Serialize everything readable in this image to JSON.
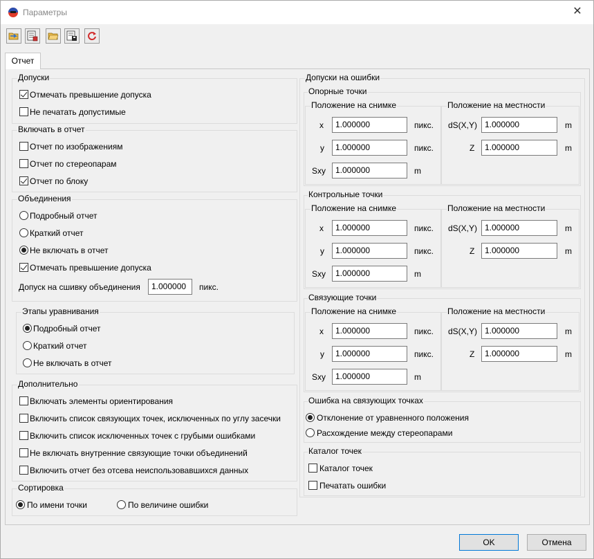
{
  "window": {
    "title": "Параметры"
  },
  "tabs": [
    "Отчет"
  ],
  "left": {
    "tolerances": {
      "title": "Допуски",
      "items": [
        {
          "label": "Отмечать превышение допуска",
          "checked": true
        },
        {
          "label": "Не печатать допустимые",
          "checked": false
        }
      ]
    },
    "include": {
      "title": "Включать в отчет",
      "items": [
        {
          "label": "Отчет по изображениям",
          "checked": false
        },
        {
          "label": "Отчет по стереопарам",
          "checked": false
        },
        {
          "label": "Отчет по блоку",
          "checked": true
        }
      ]
    },
    "merges": {
      "title": "Объединения",
      "radios": [
        {
          "label": "Подробный отчет",
          "checked": false
        },
        {
          "label": "Краткий отчет",
          "checked": false
        },
        {
          "label": "Не включать в отчет",
          "checked": true
        }
      ],
      "check": {
        "label": "Отмечать превышение допуска",
        "checked": true
      },
      "stitch_label": "Допуск на сшивку объединения",
      "stitch_value": "1.000000",
      "stitch_unit": "пикс."
    },
    "stages": {
      "title": "Этапы уравнивания",
      "radios": [
        {
          "label": "Подробный отчет",
          "checked": true
        },
        {
          "label": "Краткий отчет",
          "checked": false
        },
        {
          "label": "Не включать в отчет",
          "checked": false
        }
      ]
    },
    "extra": {
      "title": "Дополнительно",
      "items": [
        {
          "label": "Включать элементы ориентирования",
          "checked": false
        },
        {
          "label": "Включить список связующих точек, исключенных по углу засечки",
          "checked": false
        },
        {
          "label": "Включить список исключенных точек с грубыми ошибками",
          "checked": false
        },
        {
          "label": "Не включать внутренние связующие точки объединений",
          "checked": false
        },
        {
          "label": "Включить отчет без отсева неиспользовавшихся данных",
          "checked": false
        }
      ]
    },
    "sort": {
      "title": "Сортировка",
      "radios": [
        {
          "label": "По имени точки",
          "checked": true
        },
        {
          "label": "По величине ошибки",
          "checked": false
        }
      ]
    }
  },
  "right": {
    "title": "Допуски на ошибки",
    "groups": [
      {
        "title": "Опорные точки",
        "image_title": "Положение на снимке",
        "ground_title": "Положение на местности",
        "image_rows": [
          {
            "label": "x",
            "value": "1.000000",
            "unit": "пикс."
          },
          {
            "label": "y",
            "value": "1.000000",
            "unit": "пикс."
          },
          {
            "label": "Sxy",
            "value": "1.000000",
            "unit": "m"
          }
        ],
        "ground_rows": [
          {
            "label": "dS(X,Y)",
            "value": "1.000000",
            "unit": "m"
          },
          {
            "label": "Z",
            "value": "1.000000",
            "unit": "m"
          }
        ]
      },
      {
        "title": "Контрольные точки",
        "image_title": "Положение на снимке",
        "ground_title": "Положение на местности",
        "image_rows": [
          {
            "label": "x",
            "value": "1.000000",
            "unit": "пикс."
          },
          {
            "label": "y",
            "value": "1.000000",
            "unit": "пикс."
          },
          {
            "label": "Sxy",
            "value": "1.000000",
            "unit": "m"
          }
        ],
        "ground_rows": [
          {
            "label": "dS(X,Y)",
            "value": "1.000000",
            "unit": "m"
          },
          {
            "label": "Z",
            "value": "1.000000",
            "unit": "m"
          }
        ]
      },
      {
        "title": "Связующие точки",
        "image_title": "Положение на снимке",
        "ground_title": "Положение на местности",
        "image_rows": [
          {
            "label": "x",
            "value": "1.000000",
            "unit": "пикс."
          },
          {
            "label": "y",
            "value": "1.000000",
            "unit": "пикс."
          },
          {
            "label": "Sxy",
            "value": "1.000000",
            "unit": "m"
          }
        ],
        "ground_rows": [
          {
            "label": "dS(X,Y)",
            "value": "1.000000",
            "unit": "m"
          },
          {
            "label": "Z",
            "value": "1.000000",
            "unit": "m"
          }
        ]
      }
    ],
    "tie_error": {
      "title": "Ошибка на связующих точках",
      "radios": [
        {
          "label": "Отклонение от уравненного положения",
          "checked": true
        },
        {
          "label": "Расхождение между стереопарами",
          "checked": false
        }
      ]
    },
    "catalog": {
      "title": "Каталог точек",
      "items": [
        {
          "label": "Каталог точек",
          "checked": false
        },
        {
          "label": "Печатать ошибки",
          "checked": false
        }
      ]
    }
  },
  "buttons": {
    "ok": "OK",
    "cancel": "Отмена"
  },
  "icons": {
    "app": "app-icon",
    "toolbar": [
      "open-folder-arrow-icon",
      "save-list-icon",
      "open-folder-icon",
      "save-floppy-icon",
      "refresh-icon"
    ]
  }
}
